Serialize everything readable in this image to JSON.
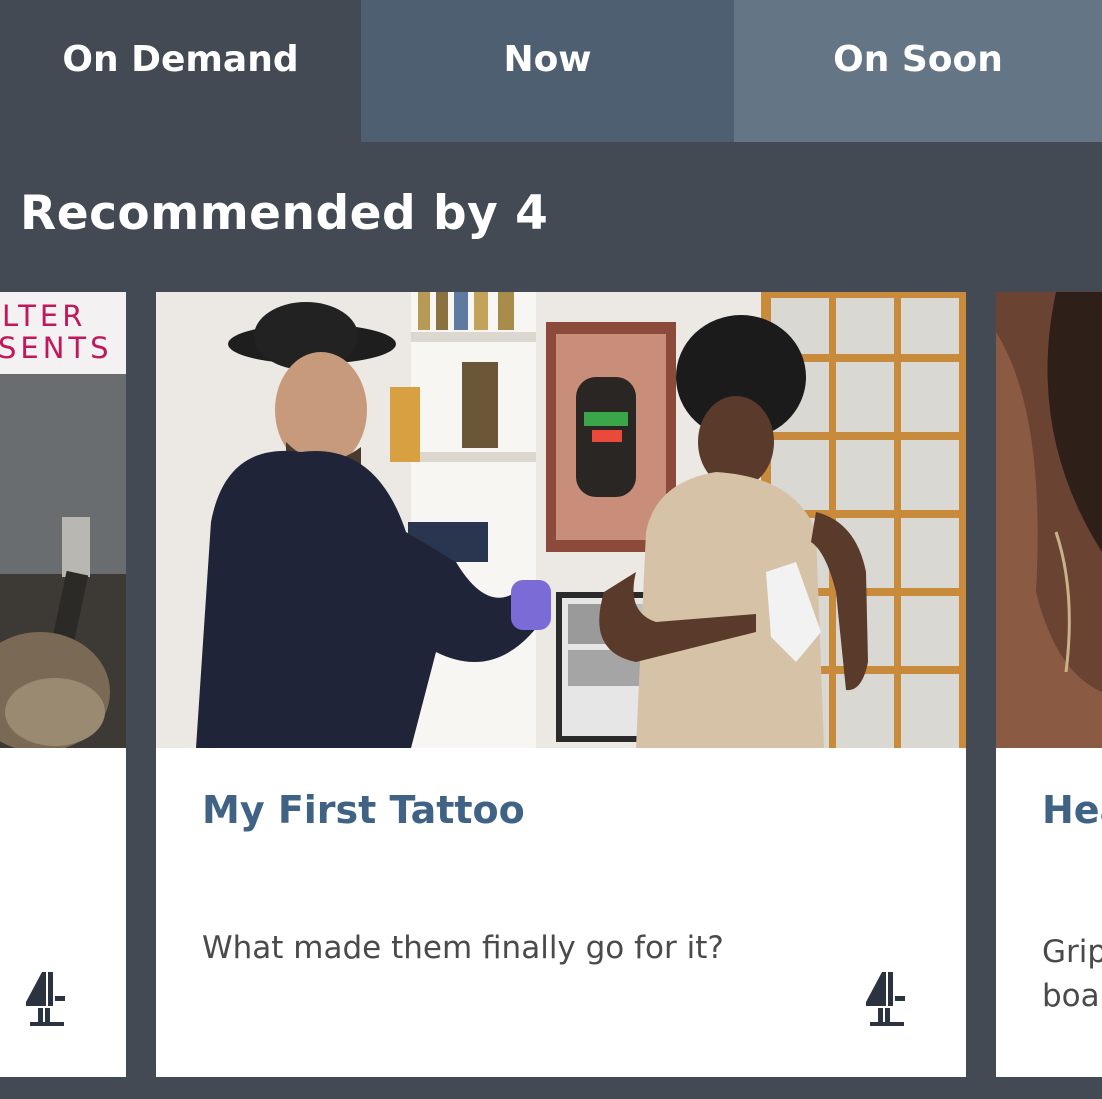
{
  "tabs": [
    {
      "label": "On Demand",
      "selected": true
    },
    {
      "label": "Now",
      "selected": false
    },
    {
      "label": "On Soon",
      "selected": false
    }
  ],
  "section": {
    "heading": "Recommended by 4"
  },
  "cards": {
    "left": {
      "banner_line1": "LTER",
      "banner_line2": "SENTS",
      "channel_logo": "channel-4-logo"
    },
    "main": {
      "title": "My First Tattoo",
      "description": "What made them finally go for it?",
      "channel_logo": "channel-4-logo"
    },
    "right": {
      "title": "Hea",
      "description_line1": "Grip",
      "description_line2": "boar"
    }
  },
  "colors": {
    "background": "#434a54",
    "tab_now": "#4d5f70",
    "tab_on_soon": "#647685",
    "card_title": "#3f6285",
    "logo": "#2b3340"
  }
}
